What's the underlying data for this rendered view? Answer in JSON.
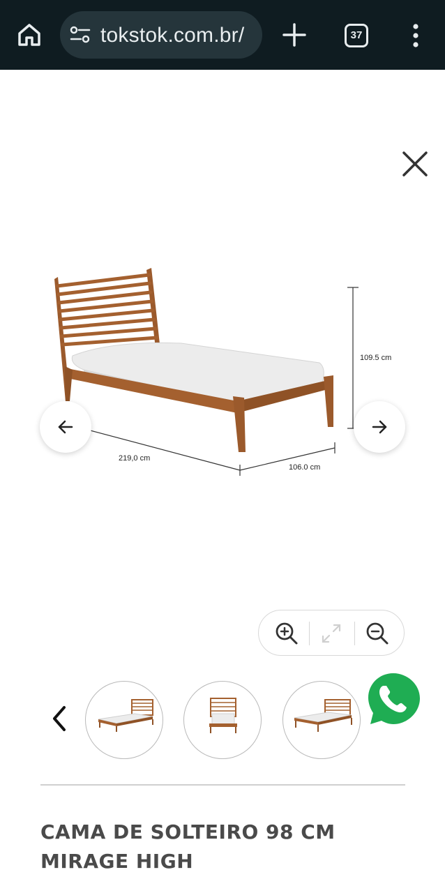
{
  "browser": {
    "url": "tokstok.com.br/",
    "tab_count": "37"
  },
  "gallery": {
    "dimensions": {
      "height": "109.5 cm",
      "length": "219,0 cm",
      "width": "106.0 cm"
    },
    "thumbnails_count": 3
  },
  "product": {
    "title_line1": "CAMA DE SOLTEIRO 98 CM",
    "title_line2": "MIRAGE HIGH"
  },
  "colors": {
    "topbar": "#0f1c21",
    "url_pill": "#25353b",
    "wood": "#a4602f",
    "mattress": "#ececec",
    "whatsapp": "#1fad53"
  }
}
